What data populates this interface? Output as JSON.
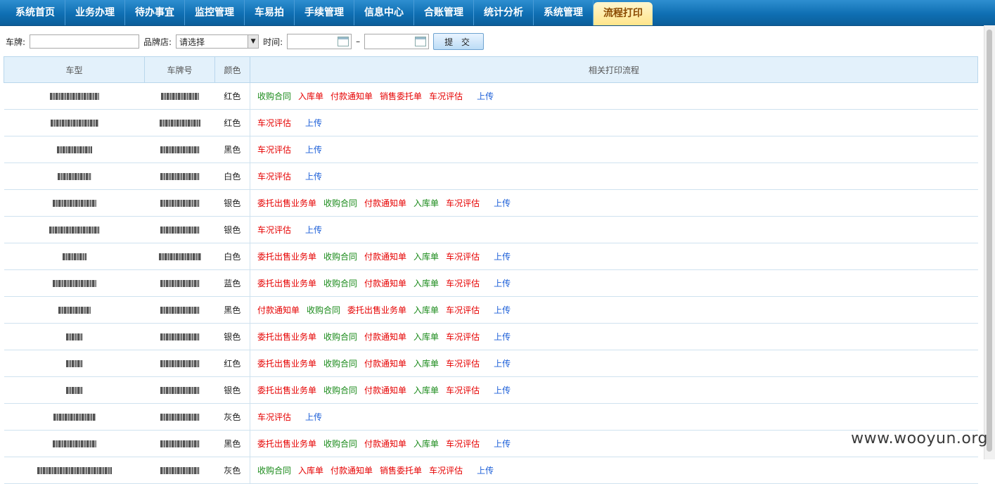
{
  "nav": {
    "items": [
      "系统首页",
      "业务办理",
      "待办事宜",
      "监控管理",
      "车易拍",
      "手续管理",
      "信息中心",
      "合账管理",
      "统计分析",
      "系统管理",
      "流程打印"
    ],
    "active_index": 10
  },
  "search": {
    "plate_label": "车牌:",
    "plate_value": "",
    "store_label": "品牌店:",
    "store_selected": "请选择",
    "time_label": "时间:",
    "time_from": "",
    "time_sep": "–",
    "time_to": "",
    "submit_label": "提 交"
  },
  "table": {
    "headers": [
      "车型",
      "车牌号",
      "颜色",
      "相关打印流程"
    ],
    "rows": [
      {
        "color": "红色",
        "links": [
          {
            "t": "收购合同",
            "c": "green"
          },
          {
            "t": "入库单",
            "c": "red"
          },
          {
            "t": "付款通知单",
            "c": "red"
          },
          {
            "t": "销售委托单",
            "c": "red"
          },
          {
            "t": "车况评估",
            "c": "red"
          }
        ],
        "upload": "上传"
      },
      {
        "color": "红色",
        "links": [
          {
            "t": "车况评估",
            "c": "red"
          }
        ],
        "upload": "上传"
      },
      {
        "color": "黑色",
        "links": [
          {
            "t": "车况评估",
            "c": "red"
          }
        ],
        "upload": "上传"
      },
      {
        "color": "白色",
        "links": [
          {
            "t": "车况评估",
            "c": "red"
          }
        ],
        "upload": "上传"
      },
      {
        "color": "银色",
        "links": [
          {
            "t": "委托出售业务单",
            "c": "red"
          },
          {
            "t": "收购合同",
            "c": "green"
          },
          {
            "t": "付款通知单",
            "c": "red"
          },
          {
            "t": "入库单",
            "c": "green"
          },
          {
            "t": "车况评估",
            "c": "red"
          }
        ],
        "upload": "上传"
      },
      {
        "color": "银色",
        "links": [
          {
            "t": "车况评估",
            "c": "red"
          }
        ],
        "upload": "上传"
      },
      {
        "color": "白色",
        "links": [
          {
            "t": "委托出售业务单",
            "c": "red"
          },
          {
            "t": "收购合同",
            "c": "green"
          },
          {
            "t": "付款通知单",
            "c": "red"
          },
          {
            "t": "入库单",
            "c": "green"
          },
          {
            "t": "车况评估",
            "c": "red"
          }
        ],
        "upload": "上传"
      },
      {
        "color": "蓝色",
        "links": [
          {
            "t": "委托出售业务单",
            "c": "red"
          },
          {
            "t": "收购合同",
            "c": "green"
          },
          {
            "t": "付款通知单",
            "c": "red"
          },
          {
            "t": "入库单",
            "c": "green"
          },
          {
            "t": "车况评估",
            "c": "red"
          }
        ],
        "upload": "上传"
      },
      {
        "color": "黑色",
        "links": [
          {
            "t": "付款通知单",
            "c": "red"
          },
          {
            "t": "收购合同",
            "c": "green"
          },
          {
            "t": "委托出售业务单",
            "c": "red"
          },
          {
            "t": "入库单",
            "c": "green"
          },
          {
            "t": "车况评估",
            "c": "red"
          }
        ],
        "upload": "上传"
      },
      {
        "color": "银色",
        "links": [
          {
            "t": "委托出售业务单",
            "c": "red"
          },
          {
            "t": "收购合同",
            "c": "green"
          },
          {
            "t": "付款通知单",
            "c": "red"
          },
          {
            "t": "入库单",
            "c": "green"
          },
          {
            "t": "车况评估",
            "c": "red"
          }
        ],
        "upload": "上传"
      },
      {
        "color": "红色",
        "links": [
          {
            "t": "委托出售业务单",
            "c": "red"
          },
          {
            "t": "收购合同",
            "c": "green"
          },
          {
            "t": "付款通知单",
            "c": "red"
          },
          {
            "t": "入库单",
            "c": "green"
          },
          {
            "t": "车况评估",
            "c": "red"
          }
        ],
        "upload": "上传"
      },
      {
        "color": "银色",
        "links": [
          {
            "t": "委托出售业务单",
            "c": "red"
          },
          {
            "t": "收购合同",
            "c": "green"
          },
          {
            "t": "付款通知单",
            "c": "red"
          },
          {
            "t": "入库单",
            "c": "green"
          },
          {
            "t": "车况评估",
            "c": "red"
          }
        ],
        "upload": "上传"
      },
      {
        "color": "灰色",
        "links": [
          {
            "t": "车况评估",
            "c": "red"
          }
        ],
        "upload": "上传"
      },
      {
        "color": "黑色",
        "links": [
          {
            "t": "委托出售业务单",
            "c": "red"
          },
          {
            "t": "收购合同",
            "c": "green"
          },
          {
            "t": "付款通知单",
            "c": "red"
          },
          {
            "t": "入库单",
            "c": "green"
          },
          {
            "t": "车况评估",
            "c": "red"
          }
        ],
        "upload": "上传"
      },
      {
        "color": "灰色",
        "links": [
          {
            "t": "收购合同",
            "c": "green"
          },
          {
            "t": "入库单",
            "c": "red"
          },
          {
            "t": "付款通知单",
            "c": "red"
          },
          {
            "t": "销售委托单",
            "c": "red"
          },
          {
            "t": "车况评估",
            "c": "red"
          }
        ],
        "upload": "上传"
      }
    ]
  },
  "watermark": "www.wooyun.org"
}
